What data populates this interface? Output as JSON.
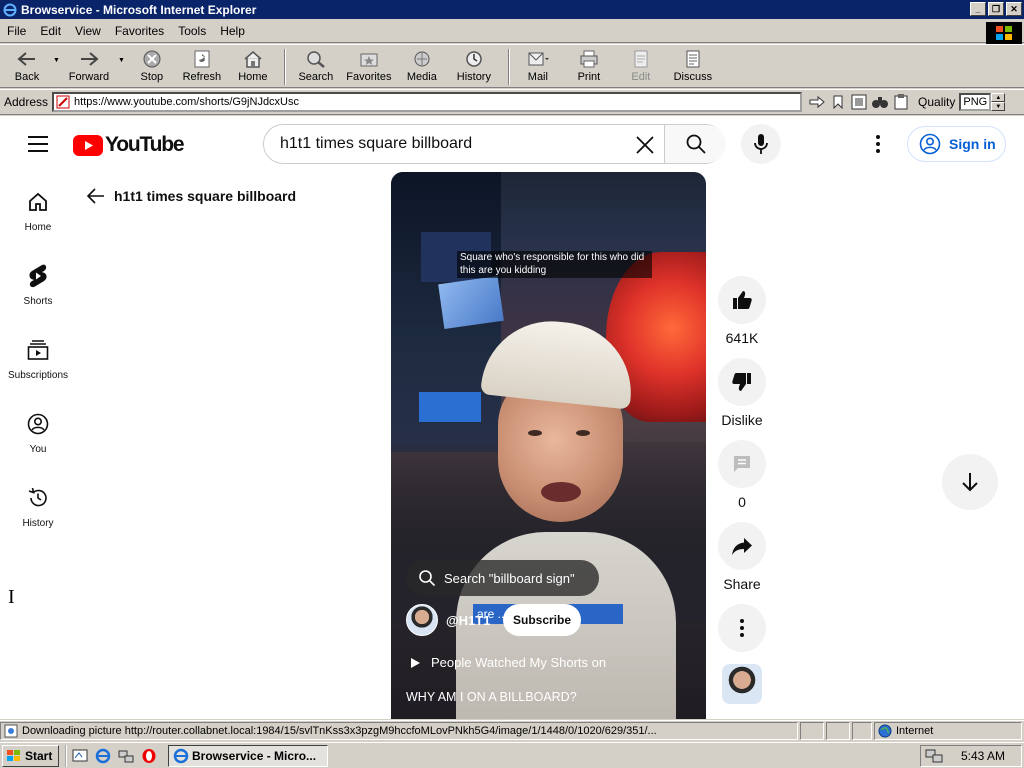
{
  "window": {
    "title": "Browservice - Microsoft Internet Explorer",
    "controls": [
      "_",
      "❐",
      "✕"
    ]
  },
  "menu": [
    "File",
    "Edit",
    "View",
    "Favorites",
    "Tools",
    "Help"
  ],
  "toolbar": {
    "back": "Back",
    "forward": "Forward",
    "stop": "Stop",
    "refresh": "Refresh",
    "home": "Home",
    "search": "Search",
    "favorites": "Favorites",
    "media": "Media",
    "history": "History",
    "mail": "Mail",
    "print": "Print",
    "edit": "Edit",
    "discuss": "Discuss"
  },
  "address": {
    "label": "Address",
    "url": "https://www.youtube.com/shorts/G9jNJdcxUsc",
    "quality_label": "Quality",
    "quality_value": "PNG"
  },
  "youtube": {
    "logo_text": "YouTube",
    "search_query": "h1t1 times square billboard",
    "sign_in": "Sign in",
    "guide": [
      {
        "label": "Home",
        "icon": "home-icon"
      },
      {
        "label": "Shorts",
        "icon": "shorts-icon"
      },
      {
        "label": "Subscriptions",
        "icon": "subscriptions-icon"
      },
      {
        "label": "You",
        "icon": "you-icon"
      },
      {
        "label": "History",
        "icon": "history-icon"
      }
    ],
    "back_title": "h1t1 times square billboard",
    "video": {
      "caption": "Square who's responsible for this who did this are you kidding",
      "search_pill": "Search \"billboard sign\"",
      "overlay_caption": "are ... ng me",
      "channel": "@H1T1",
      "subscribe": "Subscribe",
      "watched": "People Watched My Shorts on",
      "title": "WHY AM I ON A BILLBOARD?"
    },
    "actions": {
      "likes": "641K",
      "dislike": "Dislike",
      "comments": "0",
      "share": "Share"
    }
  },
  "status": {
    "text": "Downloading picture http://router.collabnet.local:1984/15/svlTnKss3x3pzgM9hccfoMLovPNkh5G4/image/1/1448/0/1020/629/351/...",
    "zone": "Internet"
  },
  "taskbar": {
    "start": "Start",
    "task": "Browservice - Micro...",
    "clock": "5:43 AM"
  },
  "colors": {
    "titlebar": "#0a246a",
    "youtube_red": "#ff0000",
    "link_blue": "#065fd4"
  }
}
